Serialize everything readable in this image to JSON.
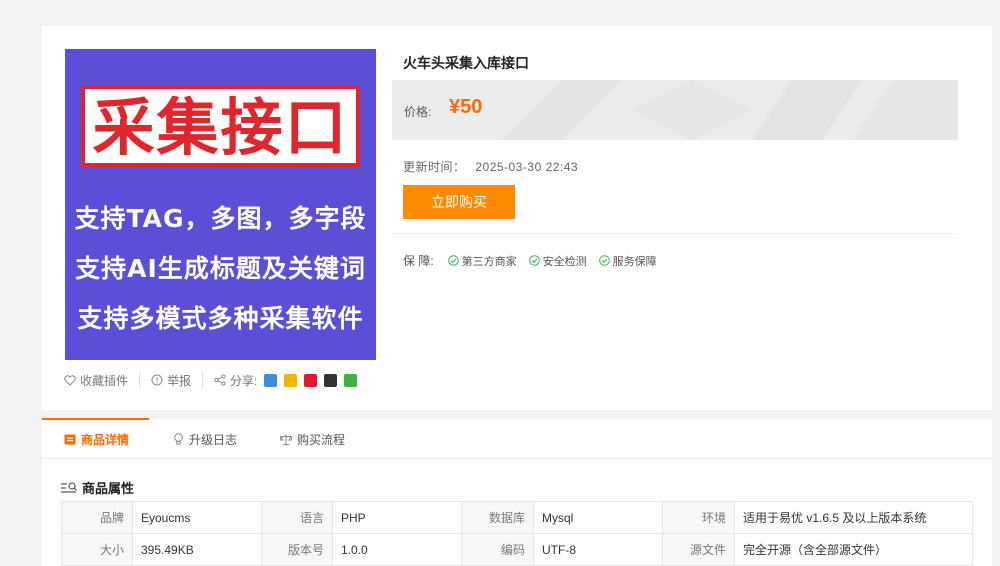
{
  "product": {
    "image": {
      "banner": "采集接口",
      "lines": [
        "支持TAG，多图，多字段",
        "支持AI生成标题及关键词",
        "支持多模式多种采集软件"
      ]
    },
    "actions": {
      "favorite": "收藏插件",
      "report": "举报",
      "share": "分享:"
    },
    "title": "火车头采集入库接口",
    "price_label": "价格:",
    "price": "¥50",
    "update_label": "更新时间：",
    "update_time": "2025-03-30 22:43",
    "buy_label": "立即购买",
    "guarantee_label": "保 障:",
    "guarantees": [
      "第三方商家",
      "安全检测",
      "服务保障"
    ]
  },
  "tabs": [
    "商品详情",
    "升级日志",
    "购买流程"
  ],
  "attributes": {
    "title": "商品属性",
    "rows": [
      [
        [
          "品牌",
          "Eyoucms"
        ],
        [
          "语言",
          "PHP"
        ],
        [
          "数据库",
          "Mysql"
        ],
        [
          "环境",
          "适用于易优 v1.6.5 及以上版本系统"
        ]
      ],
      [
        [
          "大小",
          "395.49KB"
        ],
        [
          "版本号",
          "1.0.0"
        ],
        [
          "编码",
          "UTF-8"
        ],
        [
          "源文件",
          "完全开源（含全部源文件）"
        ]
      ]
    ]
  },
  "colors": {
    "accent": "#ff6a00",
    "button": "#ff8a00",
    "image_bg": "#5a4fd6",
    "banner_red": "#e0262c",
    "check_green": "#4caf50"
  }
}
